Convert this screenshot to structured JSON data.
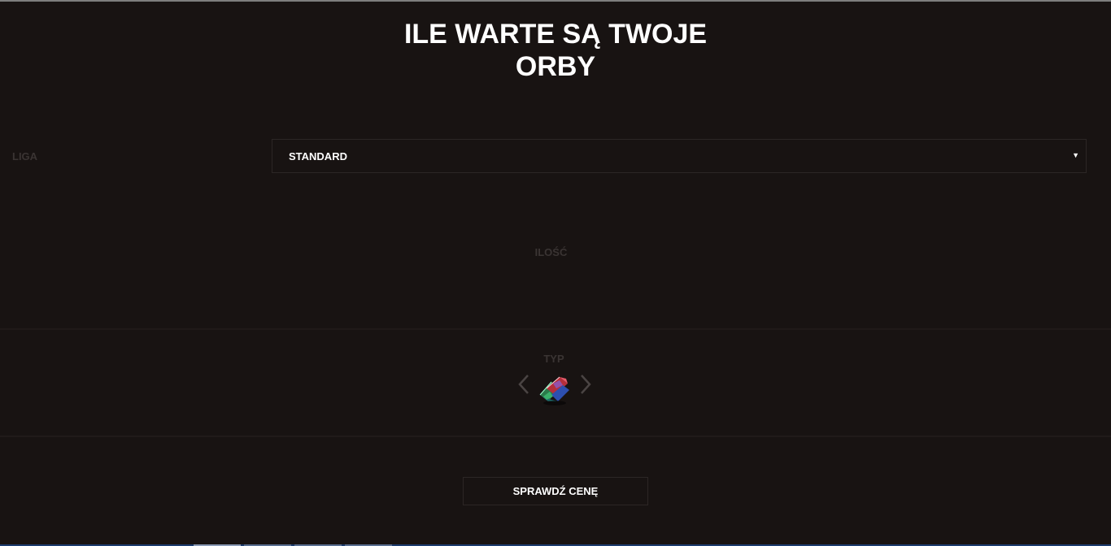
{
  "header": {
    "title_line1": "ILE WARTE SĄ TWOJE",
    "title_line2": "ORBY"
  },
  "form": {
    "liga": {
      "label": "LIGA",
      "selected": "STANDARD",
      "arrow_icon": "caret-down-icon"
    },
    "ilosc": {
      "label": "ILOŚĆ"
    },
    "typ": {
      "label": "TYP",
      "prev_icon": "chevron-left-icon",
      "next_icon": "chevron-right-icon",
      "current_icon": "chromatic-orb-icon"
    },
    "submit_label": "SPRAWDŹ CENĘ"
  },
  "colors": {
    "background": "#181312",
    "text": "#ffffff",
    "dim_label": "#3a3433",
    "border": "#2c2625"
  }
}
